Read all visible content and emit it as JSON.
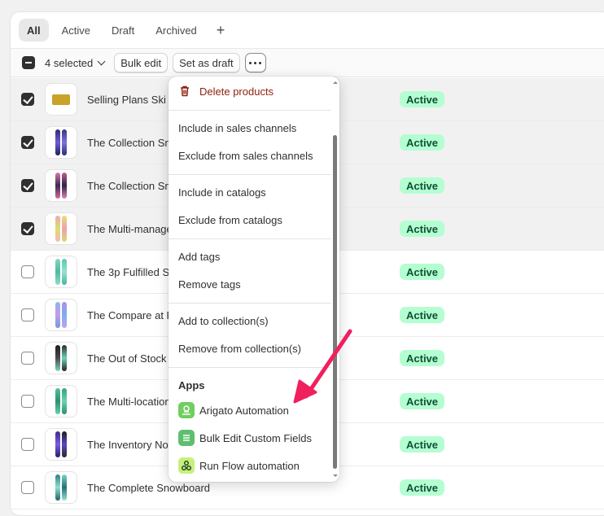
{
  "tabs": [
    {
      "label": "All"
    },
    {
      "label": "Active"
    },
    {
      "label": "Draft"
    },
    {
      "label": "Archived"
    }
  ],
  "tab_add_label": "+",
  "bulk": {
    "selected_label": "4 selected",
    "bulk_edit_label": "Bulk edit",
    "set_draft_label": "Set as draft"
  },
  "products": [
    {
      "name": "Selling Plans Ski W",
      "status": "Active",
      "checked": true
    },
    {
      "name": "The Collection Sn",
      "status": "Active",
      "checked": true
    },
    {
      "name": "The Collection Sn",
      "status": "Active",
      "checked": true
    },
    {
      "name": "The Multi-manage",
      "status": "Active",
      "checked": true
    },
    {
      "name": "The 3p Fulfilled Sn",
      "status": "Active",
      "checked": false
    },
    {
      "name": "The Compare at P",
      "status": "Active",
      "checked": false
    },
    {
      "name": "The Out of Stock S",
      "status": "Active",
      "checked": false
    },
    {
      "name": "The Multi-location",
      "status": "Active",
      "checked": false
    },
    {
      "name": "The Inventory Not",
      "status": "Active",
      "checked": false
    },
    {
      "name": "The Complete Snowboard",
      "status": "Active",
      "checked": false
    }
  ],
  "menu": {
    "delete_label": "Delete products",
    "include_channels": "Include in sales channels",
    "exclude_channels": "Exclude from sales channels",
    "include_catalogs": "Include in catalogs",
    "exclude_catalogs": "Exclude from catalogs",
    "add_tags": "Add tags",
    "remove_tags": "Remove tags",
    "add_collection": "Add to collection(s)",
    "remove_collection": "Remove from collection(s)",
    "apps_heading": "Apps",
    "apps": [
      {
        "label": "Arigato Automation",
        "icon": "arigato-app-icon"
      },
      {
        "label": "Bulk Edit Custom Fields",
        "icon": "bulk-edit-app-icon"
      },
      {
        "label": "Run Flow automation",
        "icon": "flow-app-icon"
      }
    ]
  },
  "colors": {
    "active_badge_bg": "#b4fed2",
    "active_badge_text": "#0c5132",
    "danger": "#8e1f0b",
    "annotation_arrow": "#f0205f"
  }
}
